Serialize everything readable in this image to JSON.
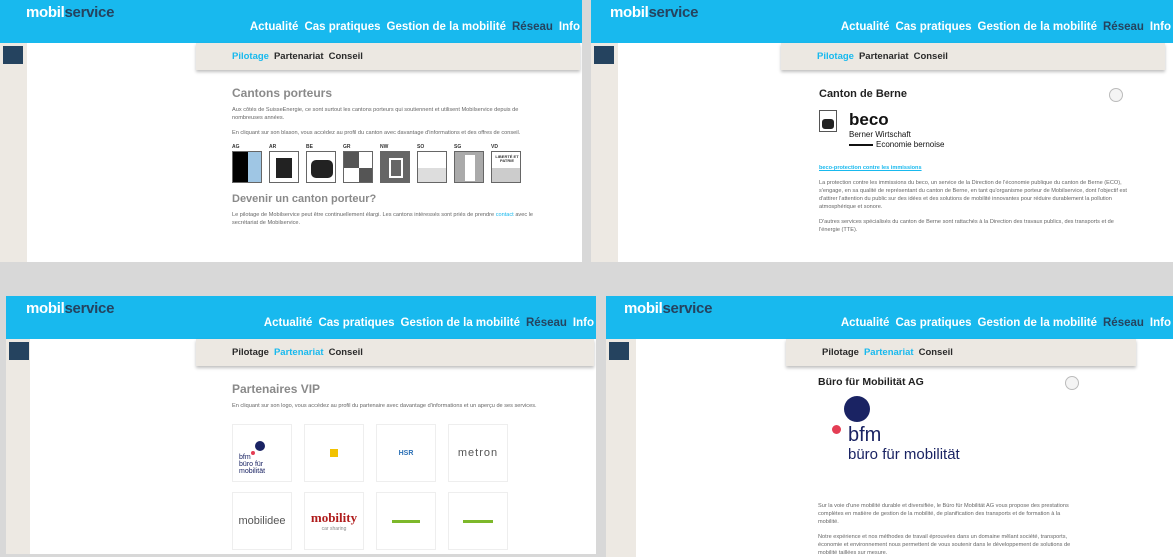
{
  "brand": {
    "logo_part1": "mobil",
    "logo_part2": "service"
  },
  "nav": [
    "Actualité",
    "Cas pratiques",
    "Gestion de la mobilité",
    "Réseau",
    "Info"
  ],
  "subnav": [
    "Pilotage",
    "Partenariat",
    "Conseil"
  ],
  "panel1": {
    "title": "Cantons porteurs",
    "intro": "Aux côtés de SuisseEnergie, ce sont surtout les cantons porteurs qui soutiennent et utilisent Mobilservice depuis de nombreuses années.",
    "click_text": "En cliquant sur son blason, vous accédez au profil du canton avec davantage d'informations et des offres de conseil.",
    "cantons": [
      "AG",
      "AR",
      "BE",
      "GR",
      "NW",
      "SO",
      "SG",
      "VD"
    ],
    "vd_motto": "LIBERTÉ ET PATRIE",
    "title2": "Devenir un canton porteur?",
    "para2_start": "Le pilotage de Mobilservice peut être continuellement élargi. Les cantons intéressés sont priés de prendre",
    "para2_link": "contact",
    "para2_end": "avec le secrétariat de Mobilservice."
  },
  "panel2": {
    "title": "Canton de Berne",
    "beco_name": "beco",
    "beco_line1": "Berner Wirtschaft",
    "beco_line2": "Economie bernoise",
    "link": "beco-protection contre les immissions",
    "para1": "La protection contre les immissions du beco, un service de la Direction de l'économie publique du canton de Berne (ECO), s'engage, en sa qualité de représentant du canton de Berne, en tant qu'organisme porteur de Mobilservice, dont l'objectif est d'attirer l'attention du public sur des idées et des solutions de mobilité innovantes pour réduire durablement la pollution atmosphérique et sonore.",
    "para2": "D'autres services spécialisés du canton de Berne sont rattachés à la Direction des travaux publics, des transports et de l'énergie (TTE)."
  },
  "panel3": {
    "title": "Partenaires VIP",
    "intro": "En cliquant sur son logo, vous accédez au profil du partenaire avec davantage d'informations et un aperçu de ses services.",
    "logo_bfm1": "bfm",
    "logo_bfm2": "büro für mobilität",
    "logo_hsr": "HSR",
    "logo_metron": "metron",
    "logo_mobilidee": "mobilidee",
    "logo_mobility": "mobility",
    "logo_mobility_sub": "car sharing"
  },
  "panel4": {
    "title": "Büro für Mobilität AG",
    "logo_t1": "bfm",
    "logo_t2": "büro für mobilität",
    "para1": "Sur la voie d'une mobilité durable et diversifiée, le Büro für Mobilität AG vous propose des prestations complètes en matière de gestion de la mobilité, de planification des transports et de formation à la mobilité.",
    "para2": "Notre expérience et nos méthodes de travail éprouvées dans un domaine mêlant société, transports, économie et environnement nous permettent de vous soutenir dans le développement de solutions de mobilité taillées sur mesure."
  },
  "colors": {
    "accent": "#18b9ee",
    "dark": "#25435f",
    "sidebar": "#ede9e3"
  }
}
